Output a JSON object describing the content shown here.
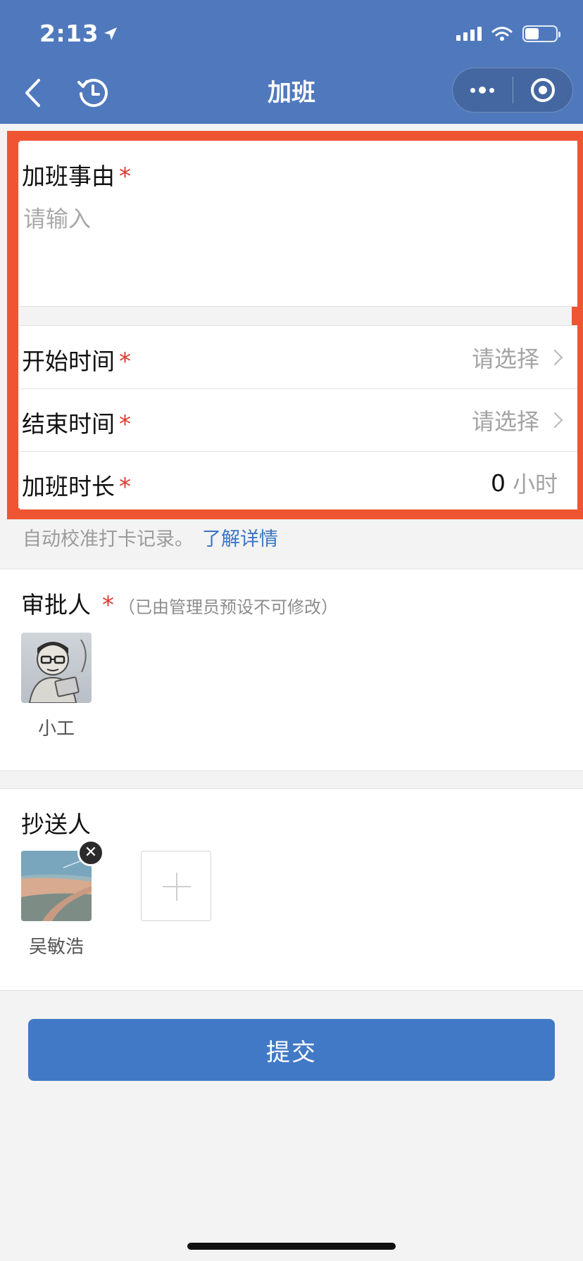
{
  "status_bar": {
    "time": "2:13",
    "battery_level": 0.45
  },
  "nav": {
    "title": "加班"
  },
  "form": {
    "reason": {
      "label": "加班事由",
      "required_mark": "*",
      "placeholder": "请输入"
    },
    "start_time": {
      "label": "开始时间",
      "required_mark": "*",
      "placeholder": "请选择"
    },
    "end_time": {
      "label": "结束时间",
      "required_mark": "*",
      "placeholder": "请选择"
    },
    "duration": {
      "label": "加班时长",
      "required_mark": "*",
      "value": "0",
      "unit": "小时"
    }
  },
  "note": {
    "text": "自动校准打卡记录。",
    "link": "了解详情"
  },
  "approver": {
    "title": "审批人",
    "required_mark": "*",
    "hint": "（已由管理员预设不可修改）",
    "people": [
      {
        "name": "小工"
      }
    ]
  },
  "cc": {
    "title": "抄送人",
    "people": [
      {
        "name": "吴敏浩"
      }
    ],
    "remove_glyph": "✕"
  },
  "submit": {
    "label": "提交"
  },
  "colors": {
    "header_bg": "#5079bd",
    "highlight_border": "#ef5532",
    "required_star": "#e03a2f",
    "link": "#3a74c4",
    "submit_bg": "#4279c7"
  }
}
